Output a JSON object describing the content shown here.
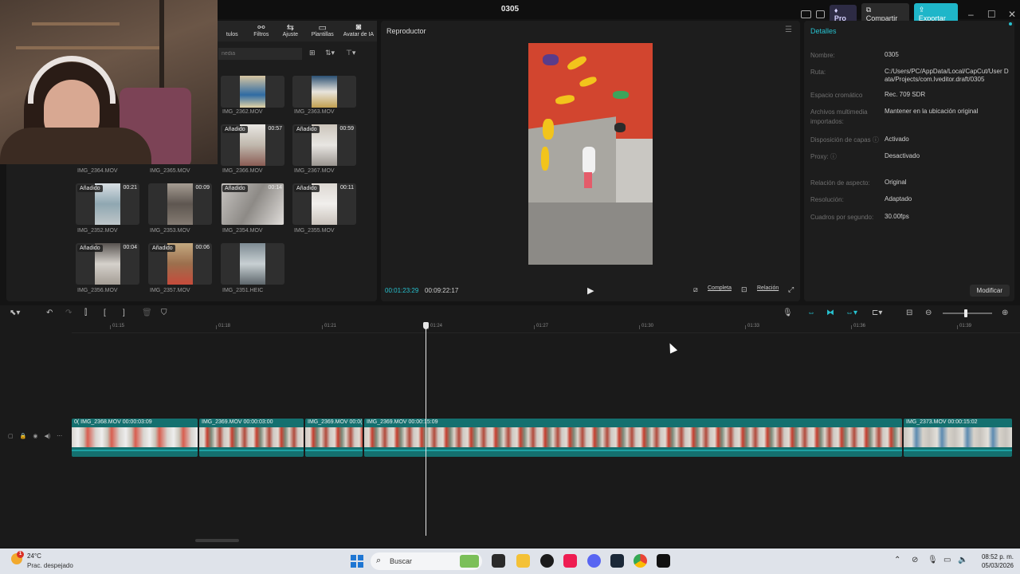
{
  "window": {
    "title": "0305",
    "pro_label": "Pro",
    "share_label": "Compartir",
    "export_label": "Exportar"
  },
  "media_tabs": [
    "tulos",
    "Filtros",
    "Ajuste",
    "Plantillas",
    "Avatar de IA"
  ],
  "media_search_placeholder": "nedia",
  "media_items": [
    {
      "name": "IMG_2362.MOV",
      "badge": "",
      "duration": ""
    },
    {
      "name": "IMG_2363.MOV",
      "badge": "",
      "duration": ""
    },
    {
      "name": "IMG_2364.MOV",
      "badge": "",
      "duration": ""
    },
    {
      "name": "IMG_2365.MOV",
      "badge": "",
      "duration": ""
    },
    {
      "name": "IMG_2366.MOV",
      "badge": "Añadido",
      "duration": "00:57"
    },
    {
      "name": "IMG_2367.MOV",
      "badge": "Añadido",
      "duration": "00:59"
    },
    {
      "name": "IMG_2352.MOV",
      "badge": "Añadido",
      "duration": "00:21"
    },
    {
      "name": "IMG_2353.MOV",
      "badge": "",
      "duration": "00:09"
    },
    {
      "name": "IMG_2354.MOV",
      "badge": "Añadido",
      "duration": "00:14"
    },
    {
      "name": "IMG_2355.MOV",
      "badge": "Añadido",
      "duration": "00:11"
    },
    {
      "name": "IMG_2356.MOV",
      "badge": "Añadido",
      "duration": "00:04"
    },
    {
      "name": "IMG_2357.MOV",
      "badge": "Añadido",
      "duration": "00:06"
    },
    {
      "name": "IMG_2351.HEIC",
      "badge": "",
      "duration": ""
    }
  ],
  "player": {
    "title": "Reproductor",
    "current_time": "00:01:23:29",
    "total_time": "00:09:22:17",
    "full_label": "Completa",
    "ratio_label": "Relación"
  },
  "details": {
    "title": "Detalles",
    "rows": [
      {
        "label": "Nombre:",
        "value": "0305"
      },
      {
        "label": "Ruta:",
        "value": "C:/Users/PC/AppData/Local/CapCut/User Data/Projects/com.lveditor.draft/0305"
      },
      {
        "label": "Espacio cromático",
        "value": "Rec. 709 SDR"
      },
      {
        "label": "Archivos multimedia importados:",
        "value": "Mantener en la ubicación original"
      },
      {
        "label": "Disposición de capas ⓘ",
        "value": "Activado"
      },
      {
        "label": "Proxy: ⓘ",
        "value": "Desactivado"
      },
      {
        "label": "Relación de aspecto:",
        "value": "Original"
      },
      {
        "label": "Resolución:",
        "value": "Adaptado"
      },
      {
        "label": "Cuadros por segundo:",
        "value": "30.00fps"
      }
    ],
    "modify_label": "Modificar"
  },
  "timeline": {
    "ruler_labels": [
      "01:15",
      "01:18",
      "01:21",
      "01:24",
      "01:27",
      "01:30",
      "01:33",
      "01:36",
      "01:39"
    ],
    "clips": [
      {
        "label": "0( IMG_2368.MOV  00:00:03:09"
      },
      {
        "label": "IMG_2369.MOV  00:00:03:00"
      },
      {
        "label": "IMG_2369.MOV  00:0("
      },
      {
        "label": "IMG_2369.MOV  00:00:15:09"
      },
      {
        "label": "IMG_2373.MOV  00:00:15:02"
      }
    ]
  },
  "taskbar": {
    "temperature": "24°C",
    "weather": "Prac. despejado",
    "alert_count": "1",
    "search_label": "Buscar",
    "time": "08:52 p. m.",
    "date": "05/03/2026"
  },
  "colors": {
    "accent": "#27c1cf",
    "clip": "#14706f",
    "panel": "#1d1d1d"
  }
}
